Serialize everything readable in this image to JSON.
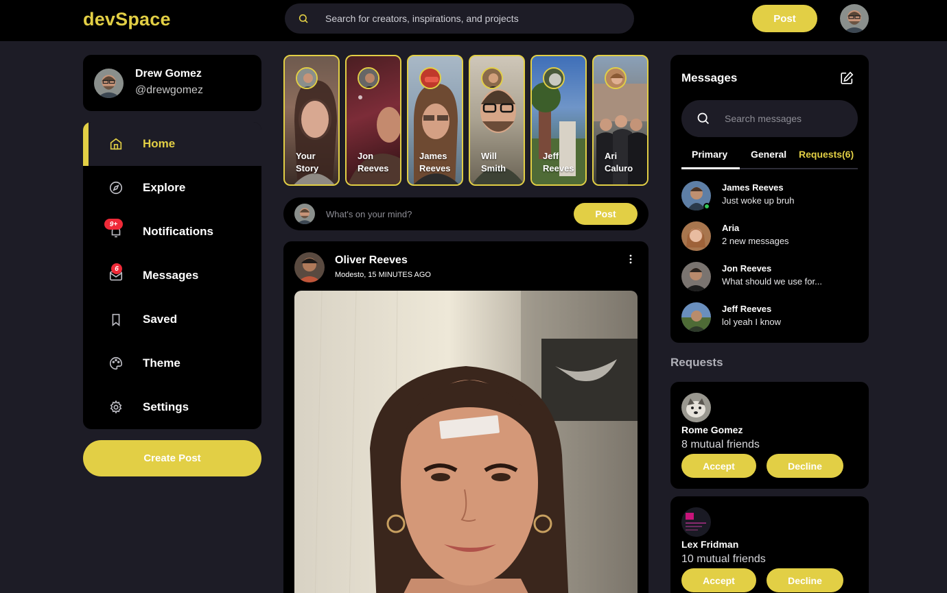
{
  "navbar": {
    "logo": "devSpace",
    "search_placeholder": "Search for creators, inspirations, and projects",
    "post_label": "Post"
  },
  "profile": {
    "name": "Drew Gomez",
    "handle": "@drewgomez"
  },
  "sidebar": {
    "items": [
      {
        "label": "Home",
        "icon": "home-icon",
        "active": true
      },
      {
        "label": "Explore",
        "icon": "compass-icon"
      },
      {
        "label": "Notifications",
        "icon": "bell-icon",
        "badge": "9+"
      },
      {
        "label": "Messages",
        "icon": "mail-icon",
        "badge": "6"
      },
      {
        "label": "Saved",
        "icon": "bookmark-icon"
      },
      {
        "label": "Theme",
        "icon": "palette-icon"
      },
      {
        "label": "Settings",
        "icon": "gear-icon"
      }
    ],
    "create_post_label": "Create Post"
  },
  "stories": [
    {
      "line1": "Your",
      "line2": "Story"
    },
    {
      "line1": "Jon",
      "line2": "Reeves"
    },
    {
      "line1": "James",
      "line2": "Reeves"
    },
    {
      "line1": "Will",
      "line2": "Smith"
    },
    {
      "line1": "Jeff",
      "line2": "Reeves"
    },
    {
      "line1": "Ari",
      "line2": "Caluro"
    }
  ],
  "composer": {
    "placeholder": "What's on your mind?",
    "post_label": "Post"
  },
  "feed": {
    "author": "Oliver Reeves",
    "meta": "Modesto, 15 MINUTES AGO"
  },
  "messages": {
    "title": "Messages",
    "search_placeholder": "Search messages",
    "tabs": {
      "primary": "Primary",
      "general": "General",
      "requests": "Requests(6)"
    },
    "rows": [
      {
        "name": "James Reeves",
        "text": "Just woke up bruh",
        "online": true
      },
      {
        "name": "Aria",
        "text": "2 new messages"
      },
      {
        "name": "Jon Reeves",
        "text": "What should we use for..."
      },
      {
        "name": "Jeff Reeves",
        "text": "lol yeah I know"
      }
    ]
  },
  "requests": {
    "heading": "Requests",
    "cards": [
      {
        "name": "Rome Gomez",
        "mutual": "8 mutual friends",
        "accept": "Accept",
        "decline": "Decline"
      },
      {
        "name": "Lex Fridman",
        "mutual": "10 mutual friends",
        "accept": "Accept",
        "decline": "Decline"
      }
    ]
  },
  "colors": {
    "accent": "#e2cf45",
    "background": "#1d1c26",
    "card": "#000000",
    "badge": "#ef2a38",
    "online": "#34c759"
  }
}
